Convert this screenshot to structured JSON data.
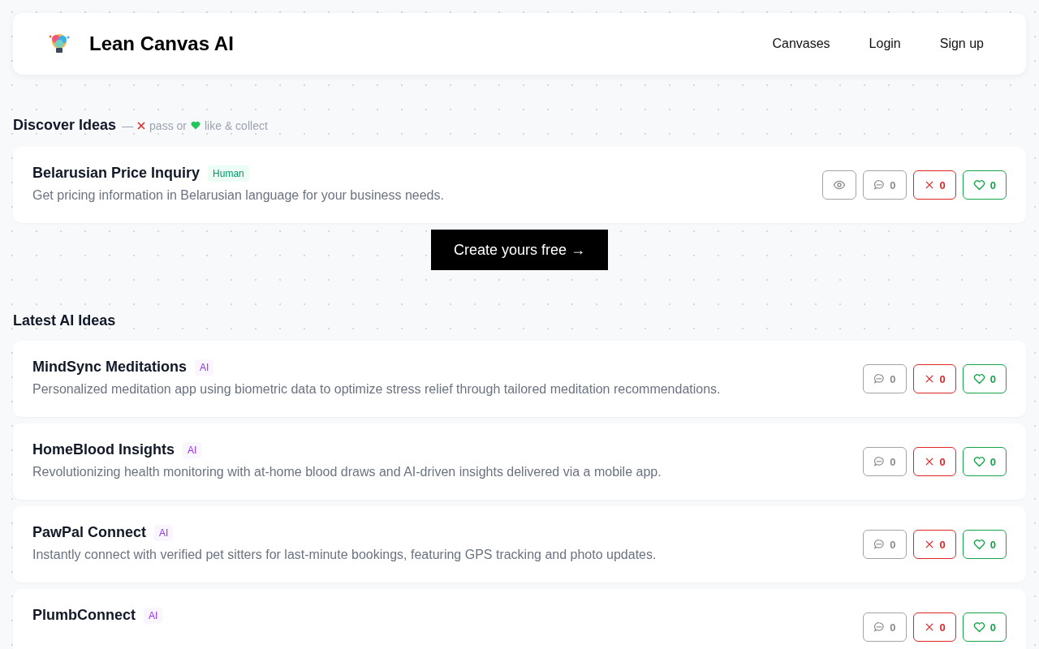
{
  "header": {
    "brand": "Lean Canvas AI",
    "nav": [
      "Canvases",
      "Login",
      "Sign up"
    ]
  },
  "discover": {
    "title": "Discover Ideas",
    "dash": "—",
    "pass": "pass or",
    "like": "like & collect",
    "ideas": [
      {
        "title": "Belarusian Price Inquiry",
        "tag": {
          "kind": "human",
          "label": "Human"
        },
        "description": "Get pricing information in Belarusian language for your business needs.",
        "actions": [
          {
            "kind": "view"
          },
          {
            "kind": "comment",
            "count": "0"
          },
          {
            "kind": "pass",
            "count": "0"
          },
          {
            "kind": "like",
            "count": "0"
          }
        ]
      }
    ]
  },
  "cta": "Create yours free →",
  "latest": {
    "title": "Latest AI Ideas",
    "ideas": [
      {
        "title": "MindSync Meditations",
        "tag": {
          "kind": "ai",
          "label": "AI"
        },
        "description": "Personalized meditation app using biometric data to optimize stress relief through tailored meditation recommendations.",
        "actions": [
          {
            "kind": "comment",
            "count": "0"
          },
          {
            "kind": "pass",
            "count": "0"
          },
          {
            "kind": "like",
            "count": "0"
          }
        ]
      },
      {
        "title": "HomeBlood Insights",
        "tag": {
          "kind": "ai",
          "label": "AI"
        },
        "description": "Revolutionizing health monitoring with at-home blood draws and AI-driven insights delivered via a mobile app.",
        "actions": [
          {
            "kind": "comment",
            "count": "0"
          },
          {
            "kind": "pass",
            "count": "0"
          },
          {
            "kind": "like",
            "count": "0"
          }
        ]
      },
      {
        "title": "PawPal Connect",
        "tag": {
          "kind": "ai",
          "label": "AI"
        },
        "description": "Instantly connect with verified pet sitters for last-minute bookings, featuring GPS tracking and photo updates.",
        "actions": [
          {
            "kind": "comment",
            "count": "0"
          },
          {
            "kind": "pass",
            "count": "0"
          },
          {
            "kind": "like",
            "count": "0"
          }
        ]
      },
      {
        "title": "PlumbConnect",
        "tag": {
          "kind": "ai",
          "label": "AI"
        },
        "actions": [
          {
            "kind": "comment",
            "count": "0"
          },
          {
            "kind": "pass",
            "count": "0"
          },
          {
            "kind": "like",
            "count": "0"
          }
        ]
      }
    ]
  }
}
